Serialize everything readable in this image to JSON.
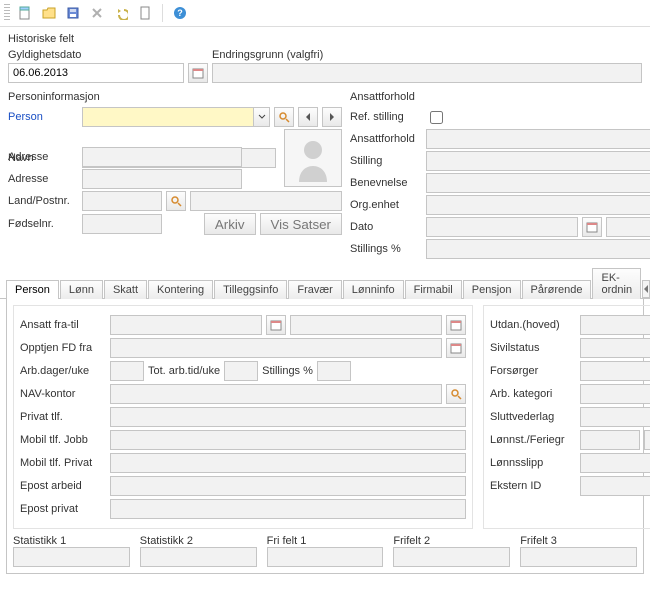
{
  "toolbar": {
    "icons": [
      "document-new",
      "folder-open",
      "save",
      "delete",
      "undo",
      "blank-doc",
      "spacer",
      "help"
    ]
  },
  "historic": {
    "title": "Historiske felt",
    "validity_label": "Gyldighetsdato",
    "validity_value": "06.06.2013",
    "reason_label": "Endringsgrunn (valgfri)",
    "reason_value": ""
  },
  "personinfo": {
    "title": "Personinformasjon",
    "person_label": "Person",
    "person_value": "",
    "navn_label": "Navn",
    "navn_value": "",
    "adresse_label": "Adresse",
    "adresse1": "",
    "adresse2": "",
    "landpost_label": "Land/Postnr.",
    "land_value": "",
    "post_value": "",
    "fodselnr_label": "Fødselnr.",
    "fodselnr_value": "",
    "arkiv_btn": "Arkiv",
    "vissatser_btn": "Vis Satser"
  },
  "ansatt": {
    "title": "Ansattforhold",
    "refstilling_label": "Ref. stilling",
    "refstilling_checked": false,
    "ansattforhold_label": "Ansattforhold",
    "ansattforhold_value": "",
    "stilling_label": "Stilling",
    "stilling_value": "",
    "benevnelse_label": "Benevnelse",
    "benevnelse_value": "",
    "orgenhet_label": "Org.enhet",
    "orgenhet_value": "",
    "dato_label": "Dato",
    "dato_from": "",
    "dato_to": "",
    "stillingspct_label": "Stillings %",
    "stillingspct_value": ""
  },
  "tabs": {
    "items": [
      "Person",
      "Lønn",
      "Skatt",
      "Kontering",
      "Tilleggsinfo",
      "Fravær",
      "Lønninfo",
      "Firmabil",
      "Pensjon",
      "Pårørende",
      "EK-ordnin"
    ],
    "active": 0
  },
  "persontab": {
    "left": {
      "ansatt_fratil": "Ansatt fra-til",
      "opptjen": "Opptjen FD fra",
      "arbdager": "Arb.dager/uke",
      "totarbtid": "Tot. arb.tid/uke",
      "stillingspct": "Stillings %",
      "navkontor": "NAV-kontor",
      "privattlf": "Privat tlf.",
      "mobiljobb": "Mobil tlf. Jobb",
      "mobilpriv": "Mobil tlf. Privat",
      "epostarb": "Epost arbeid",
      "epostpriv": "Epost privat"
    },
    "right": {
      "utdan": "Utdan.(hoved)",
      "sivil": "Sivilstatus",
      "forsorger": "Forsørger",
      "arbkat": "Arb. kategori",
      "sluttved": "Sluttvederlag",
      "lonnst": "Lønnst./Feriegr",
      "lonnsslipp": "Lønnsslipp",
      "eksternid": "Ekstern ID"
    },
    "stats": [
      "Statistikk 1",
      "Statistikk 2",
      "Fri felt 1",
      "Frifelt 2",
      "Frifelt 3"
    ]
  }
}
